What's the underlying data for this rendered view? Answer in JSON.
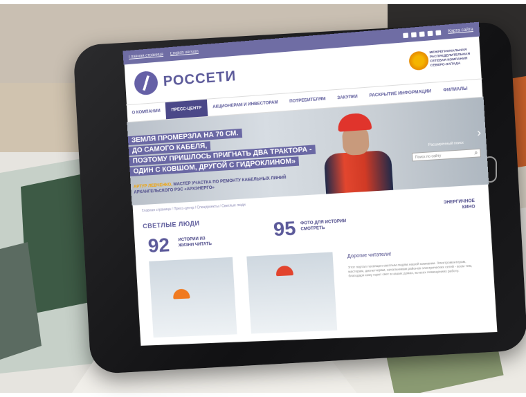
{
  "site": {
    "topbar": {
      "link1": "Главная страница",
      "link2": "English version",
      "link3": "Карта сайта"
    },
    "logo_text": "РОССЕТИ",
    "emblem_text": "МЕЖРЕГИОНАЛЬНАЯ РАСПРЕДЕЛИТЕЛЬНАЯ СЕТЕВАЯ КОМПАНИЯ СЕВЕРО-ЗАПАДА",
    "nav": [
      "О КОМПАНИИ",
      "ПРЕСС-ЦЕНТР",
      "АКЦИОНЕРАМ И ИНВЕСТОРАМ",
      "ПОТРЕБИТЕЛЯМ",
      "ЗАКУПКИ",
      "РАСКРЫТИЕ ИНФОРМАЦИИ",
      "ФИЛИАЛЫ"
    ],
    "hero": {
      "lines": [
        "ЗЕМЛЯ ПРОМЕРЗЛА НА 70 СМ.",
        "ДО САМОГО КАБЕЛЯ,",
        "ПОЭТОМУ ПРИШЛОСЬ ПРИГНАТЬ ДВА ТРАКТОРА -",
        "ОДИН С КОВШОМ, ДРУГОЙ С ГИДРОКЛИНОМ»"
      ],
      "caption_name": "АРТУР ЛЕВЧЕНКО,",
      "caption_text": "МАСТЕР УЧАСТКА ПО РЕМОНТУ КАБЕЛЬНЫХ ЛИНИЙ АРХАНГЕЛЬСКОГО РЭС «АРХЭНЕРГО»",
      "search_label": "Расширенный поиск",
      "search_placeholder": "Поиск по сайту"
    },
    "breadcrumb": "Главная страница / Пресс-центр / Спецпроекты / Светлые люди",
    "section_title": "СВЕТЛЫЕ ЛЮДИ",
    "stat1": {
      "num": "92",
      "label": "ИСТОРИИ ИЗ ЖИЗНИ ЧИТАТЬ"
    },
    "stat2": {
      "num": "95",
      "label": "ФОТО ДЛЯ ИСТОРИИ СМОТРЕТЬ"
    },
    "stat3": "ЭНЕРГИЧНОЕ КИНО",
    "letter_title": "Дорогие читатели!",
    "letter_body": "Этот портал посвящен светлым людям нашей компании. Электромонтерам, мастерам, диспетчерам, начальникам районов электрических сетей - всем тем, благодаря кому горит свет в наших домах, во всех помещениях работу."
  }
}
